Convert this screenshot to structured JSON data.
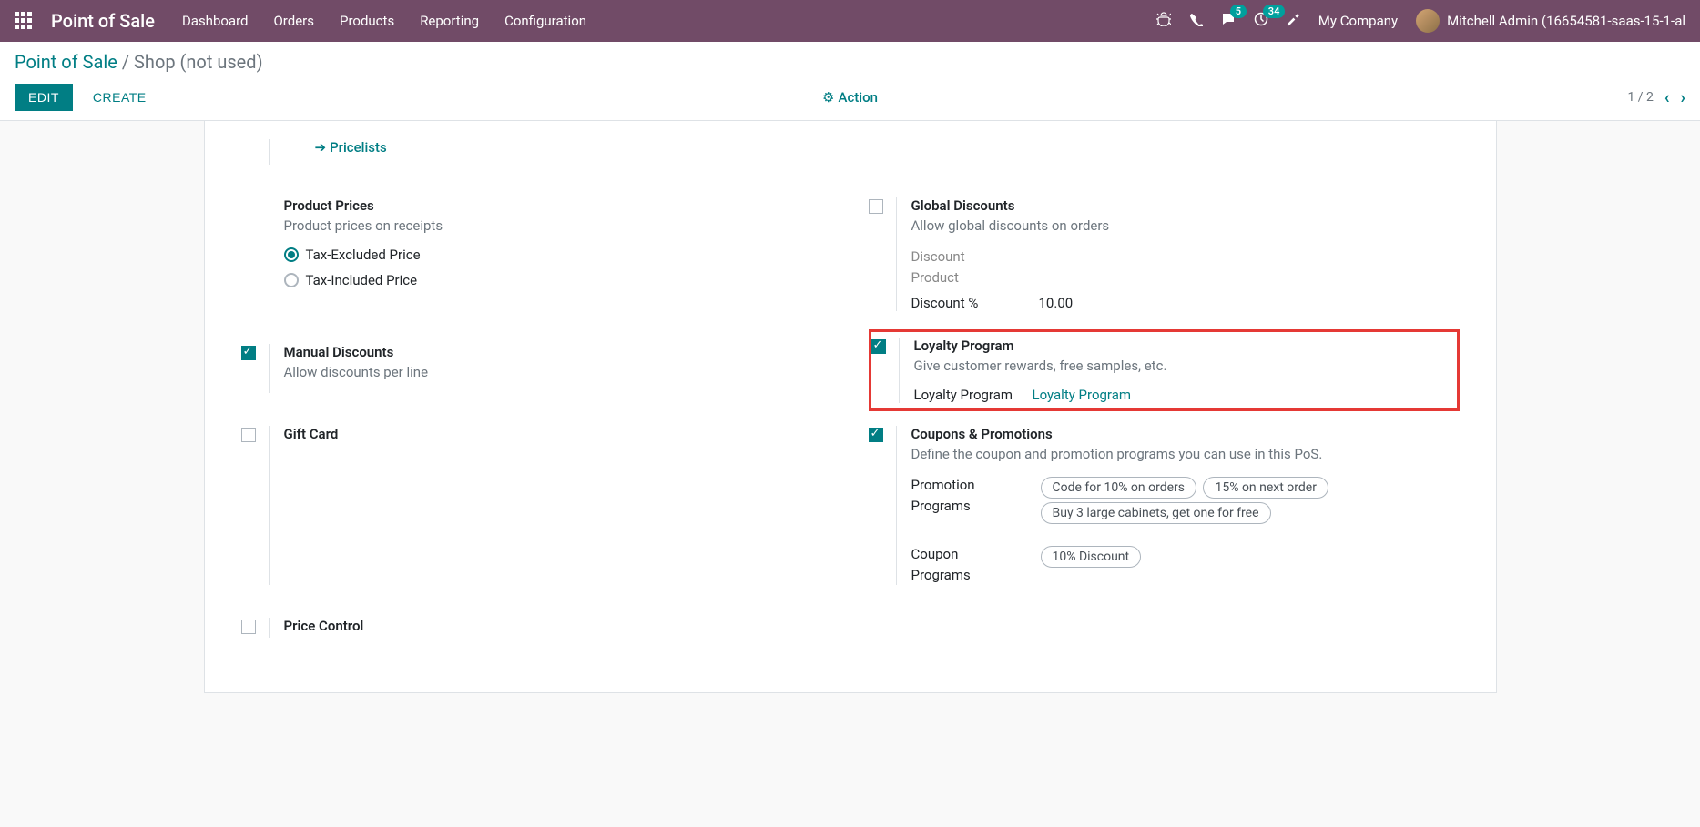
{
  "navbar": {
    "brand": "Point of Sale",
    "menu": [
      "Dashboard",
      "Orders",
      "Products",
      "Reporting",
      "Configuration"
    ],
    "messages_badge": "5",
    "activities_badge": "34",
    "company": "My Company",
    "user": "Mitchell Admin (16654581-saas-15-1-al"
  },
  "breadcrumb": {
    "root": "Point of Sale",
    "current": "Shop (not used)"
  },
  "buttons": {
    "edit": "EDIT",
    "create": "CREATE",
    "action": "Action"
  },
  "pager": {
    "text": "1 / 2"
  },
  "pricelists_link": "Pricelists",
  "settings": {
    "product_prices": {
      "title": "Product Prices",
      "desc": "Product prices on receipts",
      "opt1": "Tax-Excluded Price",
      "opt2": "Tax-Included Price"
    },
    "global_discounts": {
      "title": "Global Discounts",
      "desc": "Allow global discounts on orders",
      "discount_product_label": "Discount Product",
      "discount_pct_label": "Discount %",
      "discount_pct_value": "10.00"
    },
    "manual_discounts": {
      "title": "Manual Discounts",
      "desc": "Allow discounts per line"
    },
    "loyalty": {
      "title": "Loyalty Program",
      "desc": "Give customer rewards, free samples, etc.",
      "field_label": "Loyalty Program",
      "field_value": "Loyalty Program"
    },
    "gift_card": {
      "title": "Gift Card"
    },
    "coupons": {
      "title": "Coupons & Promotions",
      "desc": "Define the coupon and promotion programs you can use in this PoS.",
      "promo_label": "Promotion Programs",
      "promo_tags": [
        "Code for 10% on orders",
        "15% on next order",
        "Buy 3 large cabinets, get one for free"
      ],
      "coupon_label": "Coupon Programs",
      "coupon_tags": [
        "10% Discount"
      ]
    },
    "price_control": {
      "title": "Price Control"
    }
  }
}
